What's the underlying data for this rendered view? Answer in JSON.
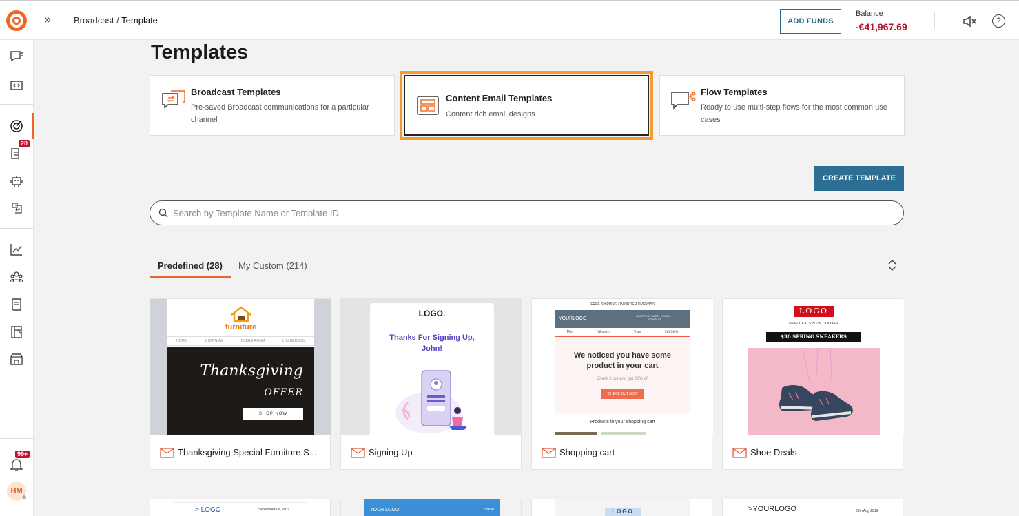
{
  "header": {
    "breadcrumb_parent": "Broadcast /",
    "breadcrumb_current": "Template",
    "add_funds_label": "ADD FUNDS",
    "balance_label": "Balance",
    "balance_value": "-€41,967.69",
    "help_label": "?"
  },
  "sidebar": {
    "badge_campaigns": "20",
    "badge_notifications": "99+",
    "avatar_initials": "HM"
  },
  "page": {
    "title": "Templates"
  },
  "template_types": [
    {
      "title": "Broadcast Templates",
      "description": "Pre-saved Broadcast communications for a particular channel"
    },
    {
      "title": "Content Email Templates",
      "description": "Content rich email designs"
    },
    {
      "title": "Flow Templates",
      "description": "Ready to use multi-step flows for the most common use cases"
    }
  ],
  "create_template_label": "CREATE TEMPLATE",
  "search": {
    "placeholder": "Search by Template Name or Template ID",
    "value": ""
  },
  "tabs": [
    {
      "label": "Predefined (28)",
      "active": true
    },
    {
      "label": "My Custom (214)",
      "active": false
    }
  ],
  "templates": [
    {
      "name": "Thanksgiving Special Furniture S...",
      "preview": {
        "brand": "furniture",
        "nav": [
          "HOME",
          "SHOP NOW",
          "DINING ROOM",
          "LIVING ROOM"
        ],
        "headline": "Thanksgiving",
        "subheadline": "OFFER",
        "cta": "SHOP NOW"
      }
    },
    {
      "name": "Signing Up",
      "preview": {
        "logo": "LOGO.",
        "headline": "Thanks For Signing Up, John!"
      }
    },
    {
      "name": "Shopping cart",
      "preview": {
        "banner": "FREE SHIPPING ON ORDER OVER $50",
        "logo": "YOURLOGO",
        "links": [
          "SHOPPING CART",
          "LOGIN",
          "CONTACT"
        ],
        "cats": [
          "Men",
          "Women",
          "Toys",
          "LifeStyle"
        ],
        "headline": "We noticed you have some product in your cart",
        "sub": "Check it out and get 20% off",
        "cta": "CHECK OUT NOW",
        "footer": "Products in your shopping cart"
      }
    },
    {
      "name": "Shoe Deals",
      "preview": {
        "logo": "LOGO",
        "tagline": "NEW DEALS NEW COLORS",
        "banner": "$30 SPRING SNEAKERS"
      }
    }
  ],
  "templates_row2": [
    {
      "logo": "LOGO",
      "date": "September 06, 2019"
    },
    {
      "logo": "YOUR LOGO",
      "link": "SHOP"
    },
    {
      "logo": "LOGO"
    },
    {
      "logo": "YOURLOGO",
      "date": "30th Aug 2019"
    }
  ],
  "colors": {
    "accent": "#f26522",
    "primary_button": "#2d6f94",
    "balance_negative": "#b5142b",
    "selected_outline": "#f29a38"
  }
}
